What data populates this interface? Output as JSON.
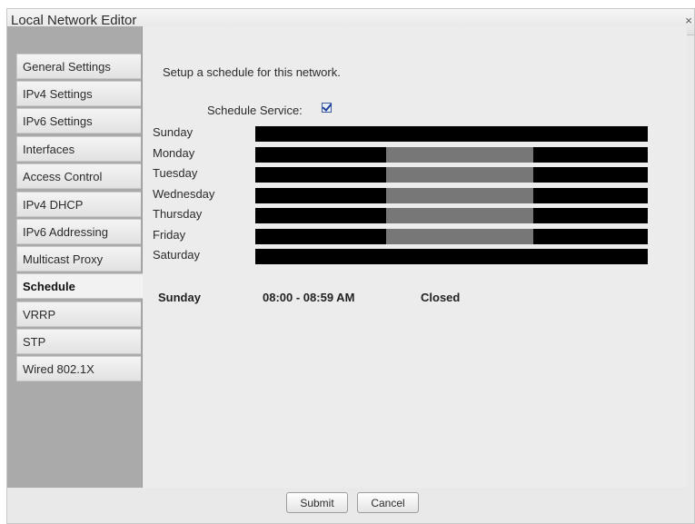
{
  "window": {
    "title": "Local Network Editor",
    "close_glyph": "×"
  },
  "sidebar": {
    "items": [
      {
        "label": "General Settings"
      },
      {
        "label": "IPv4 Settings"
      },
      {
        "label": "IPv6 Settings"
      },
      {
        "label": "Interfaces"
      },
      {
        "label": "Access Control"
      },
      {
        "label": "IPv4 DHCP"
      },
      {
        "label": "IPv6 Addressing"
      },
      {
        "label": "Multicast Proxy"
      },
      {
        "label": "Schedule",
        "active": true
      },
      {
        "label": "VRRP"
      },
      {
        "label": "STP"
      },
      {
        "label": "Wired 802.1X"
      }
    ]
  },
  "schedule": {
    "intro": "Setup a schedule for this network.",
    "service_label": "Schedule Service:",
    "service_enabled": true,
    "days": [
      {
        "name": "Sunday",
        "open_from": null,
        "open_to": null
      },
      {
        "name": "Monday",
        "open_from": "8:00",
        "open_to": "17:00"
      },
      {
        "name": "Tuesday",
        "open_from": "8:00",
        "open_to": "17:00"
      },
      {
        "name": "Wednesday",
        "open_from": "8:00",
        "open_to": "17:00"
      },
      {
        "name": "Thursday",
        "open_from": "8:00",
        "open_to": "17:00"
      },
      {
        "name": "Friday",
        "open_from": "8:00",
        "open_to": "17:00"
      },
      {
        "name": "Saturday",
        "open_from": null,
        "open_to": null
      }
    ],
    "summary": {
      "day": "Sunday",
      "time": "08:00 - 08:59 AM",
      "status": "Closed"
    }
  },
  "footer": {
    "submit_label": "Submit",
    "cancel_label": "Cancel"
  },
  "colors": {
    "closed": "#000000",
    "open": "#777777"
  }
}
